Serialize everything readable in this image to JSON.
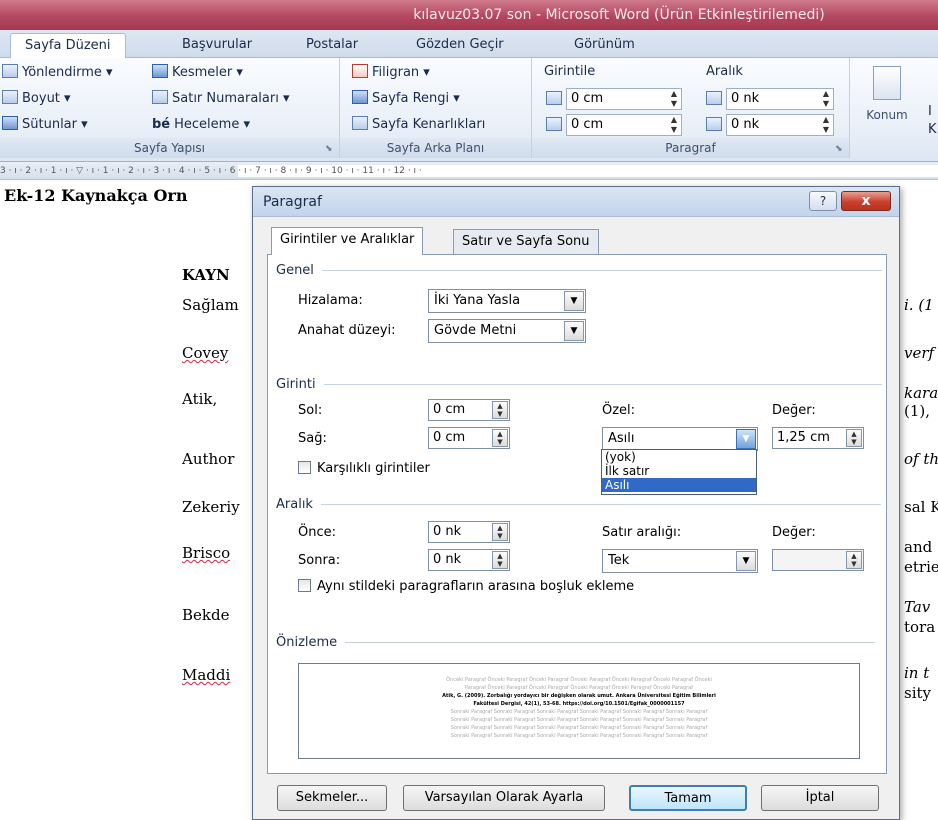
{
  "window": {
    "title": "kılavuz03.07 son  -  Microsoft Word (Ürün Etkinleştirilemedi)"
  },
  "ribbon_tabs": [
    "Sayfa Düzeni",
    "Başvurular",
    "Postalar",
    "Gözden Geçir",
    "Görünüm"
  ],
  "ribbon": {
    "sayfa_yapisi": {
      "caption": "Sayfa Yapısı",
      "items": [
        "Yönlendirme ▾",
        "Kesmeler ▾",
        "Boyut ▾",
        "Satır Numaraları ▾",
        "Sütunlar ▾",
        "Heceleme ▾"
      ],
      "heceleme_prefix": "bé"
    },
    "sayfa_arka_plani": {
      "caption": "Sayfa Arka Planı",
      "items": [
        "Filigran ▾",
        "Sayfa Rengi ▾",
        "Sayfa Kenarlıkları"
      ]
    },
    "paragraf": {
      "caption": "Paragraf",
      "girintile_label": "Girintile",
      "aralik_label": "Aralık",
      "sol_value": "0 cm",
      "sag_value": "0 cm",
      "once_value": "0 nk",
      "sonra_value": "0 nk"
    },
    "konum": {
      "label": "Konum",
      "truncated_1": "I",
      "truncated_2": "K"
    }
  },
  "ruler": {
    "text": "3 · ı · 2 · ı · 1 · ı · ▽ · ı · 1 · ı · 2 · ı · 3 · ı · 4 · ı · 5 · ı · 6 · ı · 7 · ı · 8 · ı · 9 · ı · 10 · ı · 11 · ı · 12 · ı ·"
  },
  "document": {
    "heading": "Ek-12 Kaynakça Orn",
    "left_lines": [
      "KAYN",
      "Sağlam",
      "Covey",
      "Atik,",
      "Author",
      "Zekeriy",
      "Brisco",
      "Bekde",
      "Maddi"
    ],
    "right_lines": [
      "i. (1",
      "verf",
      "kara",
      "(1),",
      "of th",
      "sal K",
      "and",
      "etrie",
      "Tav",
      "tora",
      "in t",
      "sity"
    ]
  },
  "dialog": {
    "title": "Paragraf",
    "help": "?",
    "close": "x",
    "tabs": [
      "Girintiler ve Aralıklar",
      "Satır ve Sayfa Sonu"
    ],
    "genel": {
      "label": "Genel",
      "hizalama_label": "Hizalama:",
      "hizalama_value": "İki Yana Yasla",
      "anahat_label": "Anahat düzeyi:",
      "anahat_value": "Gövde Metni"
    },
    "girinti": {
      "label": "Girinti",
      "sol_label": "Sol:",
      "sol_value": "0 cm",
      "sag_label": "Sağ:",
      "sag_value": "0 cm",
      "ozel_label": "Özel:",
      "ozel_value": "Asılı",
      "deger_label": "Değer:",
      "deger_value": "1,25 cm",
      "karsilikli_label": "Karşılıklı girintiler",
      "ozel_options": [
        "(yok)",
        "İlk satır",
        "Asılı"
      ],
      "ozel_selected_index": 2
    },
    "aralik": {
      "label": "Aralık",
      "once_label": "Önce:",
      "once_value": "0 nk",
      "sonra_label": "Sonra:",
      "sonra_value": "0 nk",
      "satir_label": "Satır aralığı:",
      "satir_value": "Tek",
      "deger_label": "Değer:",
      "deger_value": "",
      "ayni_stil_label": "Aynı stildeki paragrafların arasına boşluk ekleme"
    },
    "onizleme": {
      "label": "Önizleme",
      "prev": [
        "Önceki Paragraf Önceki Paragraf Önceki Paragraf Önceki Paragraf Önceki Paragraf Önceki Paragraf Önceki",
        "Paragraf Önceki Paragraf Önceki Paragraf Önceki Paragraf Önceki Paragraf Önceki Paragraf"
      ],
      "current": [
        "Atik, G. (2009). Zorbalığı yordayıcı bir değişken olarak umut. Ankara Üniversitesi Eğitim Bilimleri",
        "Fakültesi Dergisi, 42(1), 53-68. https://doi.org/10.1501/Egifak_0000001157"
      ],
      "next": [
        "Sonraki Paragraf Sonraki Paragraf Sonraki Paragraf Sonraki Paragraf Sonraki Paragraf Sonraki Paragraf",
        "Sonraki Paragraf Sonraki Paragraf Sonraki Paragraf Sonraki Paragraf Sonraki Paragraf Sonraki Paragraf",
        "Sonraki Paragraf Sonraki Paragraf Sonraki Paragraf Sonraki Paragraf Sonraki Paragraf Sonraki Paragraf",
        "Sonraki Paragraf Sonraki Paragraf Sonraki Paragraf Sonraki Paragraf Sonraki Paragraf Sonraki Paragraf"
      ]
    },
    "buttons": {
      "sekmeler": "Sekmeler...",
      "varsayilan": "Varsayılan Olarak Ayarla",
      "tamam": "Tamam",
      "iptal": "İptal"
    }
  }
}
